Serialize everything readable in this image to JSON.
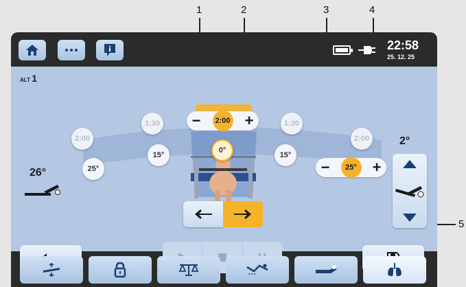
{
  "callouts": [
    "1",
    "2",
    "3",
    "4",
    "5"
  ],
  "status": {
    "time": "22:58",
    "date": "25. 12. 25"
  },
  "header": {
    "buttons": [
      {
        "icon": "home-icon"
      },
      {
        "icon": "more-icon"
      },
      {
        "icon": "info-icon"
      }
    ]
  },
  "screen": {
    "alt_prefix": "ALT",
    "alt_value": "1",
    "time_control": {
      "minus": "−",
      "value": "2:00",
      "plus": "+"
    },
    "angle_control": {
      "minus": "−",
      "value": "25°",
      "plus": "+"
    },
    "arc_labels": {
      "left_time_1": "1:30",
      "left_time_2": "2:00",
      "right_time_1": "1:30",
      "right_time_2": "2:00",
      "left_angle_1": "15°",
      "left_angle_2": "25°",
      "right_angle_1": "15°",
      "center_angle": "0°"
    },
    "left_angle": "26°",
    "right_angle": "2°"
  },
  "bottom_nav": [
    {
      "icon": "bed-tilt-icon",
      "active": false
    },
    {
      "icon": "lock-icon",
      "active": false
    },
    {
      "icon": "scale-icon",
      "active": false
    },
    {
      "icon": "patient-position-icon",
      "active": false
    },
    {
      "icon": "bed-flat-icon",
      "active": false
    },
    {
      "icon": "lungs-icon",
      "active": true
    }
  ],
  "colors": {
    "accent": "#f5b32a",
    "screen_bg": "#b4c8e4",
    "device": "#2b2b2b"
  }
}
